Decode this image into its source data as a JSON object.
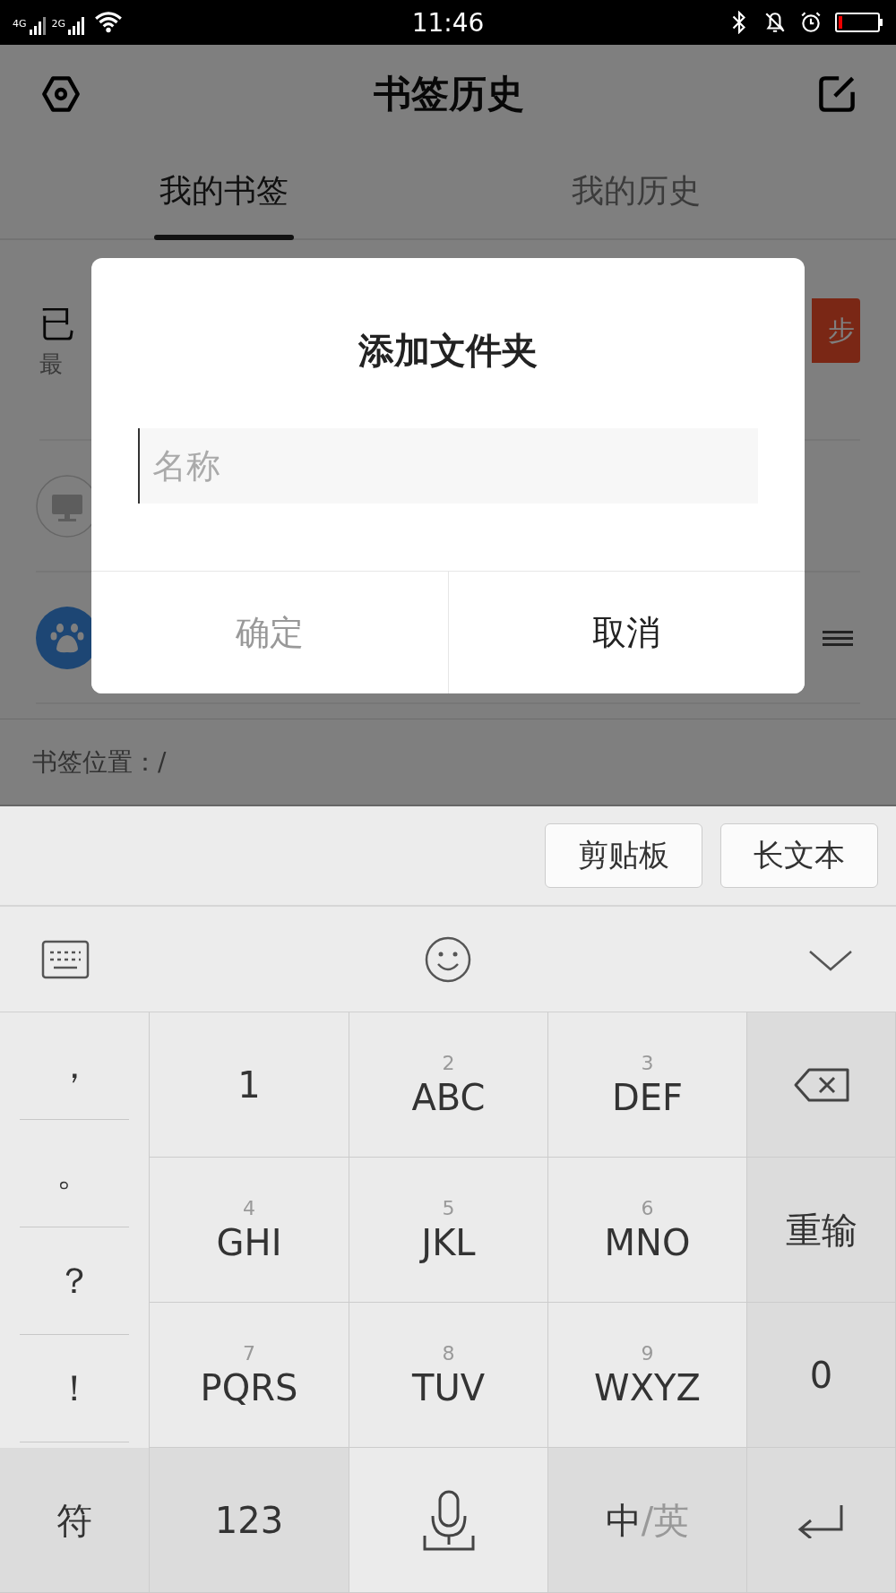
{
  "status_bar": {
    "network_1": "4G",
    "network_2": "2G",
    "time": "11:46"
  },
  "header": {
    "title": "书签历史"
  },
  "tabs": [
    {
      "label": "我的书签",
      "selected": true
    },
    {
      "label": "我的历史",
      "selected": false
    }
  ],
  "account": {
    "title": "已",
    "subtitle": "最",
    "sync_button": "步"
  },
  "bookmark_location": "书签位置：/",
  "dialog": {
    "title": "添加文件夹",
    "input": {
      "placeholder": "名称"
    },
    "buttons": [
      {
        "label": "确定",
        "kind": "confirm"
      },
      {
        "label": "取消",
        "kind": "cancel"
      }
    ]
  },
  "keyboard": {
    "toolbar_buttons": [
      "剪贴板",
      "长文本"
    ],
    "punctuation": [
      "，",
      "。",
      "？",
      "！"
    ],
    "keys": [
      {
        "kind": "char",
        "label": "1"
      },
      {
        "kind": "letter",
        "digit": "2",
        "label": "ABC"
      },
      {
        "kind": "letter",
        "digit": "3",
        "label": "DEF"
      },
      {
        "kind": "backspace"
      },
      {
        "kind": "letter",
        "digit": "4",
        "label": "GHI"
      },
      {
        "kind": "letter",
        "digit": "5",
        "label": "JKL"
      },
      {
        "kind": "letter",
        "digit": "6",
        "label": "MNO"
      },
      {
        "kind": "func",
        "label": "重输"
      },
      {
        "kind": "letter",
        "digit": "7",
        "label": "PQRS"
      },
      {
        "kind": "letter",
        "digit": "8",
        "label": "TUV"
      },
      {
        "kind": "letter",
        "digit": "9",
        "label": "WXYZ"
      },
      {
        "kind": "func",
        "label": "0"
      }
    ],
    "bottom_keys": [
      {
        "kind": "func",
        "label": "符"
      },
      {
        "kind": "func",
        "label": "123"
      },
      {
        "kind": "mic"
      },
      {
        "kind": "lang",
        "label": "中",
        "alt": "/英"
      },
      {
        "kind": "enter"
      }
    ]
  }
}
